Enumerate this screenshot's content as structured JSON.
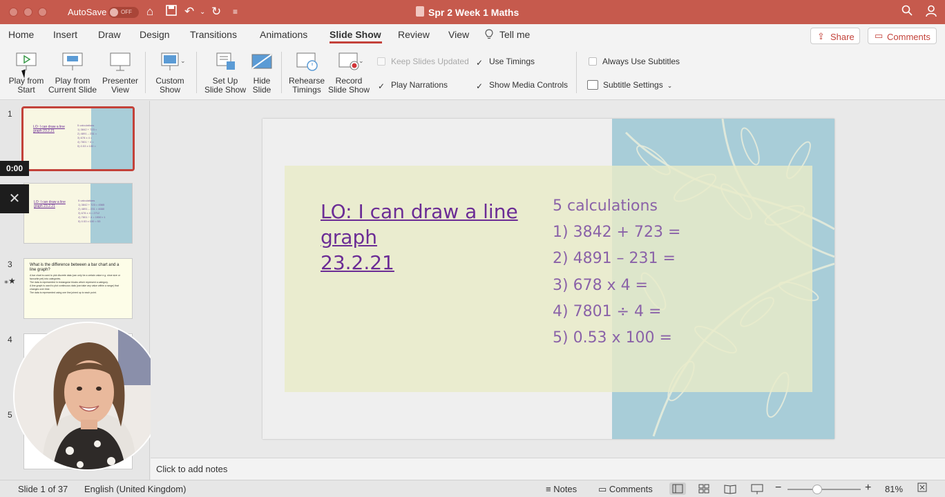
{
  "titlebar": {
    "autosave_label": "AutoSave",
    "autosave_state": "OFF",
    "document_title": "Spr 2 Week 1 Maths"
  },
  "tabs": [
    "Home",
    "Insert",
    "Draw",
    "Design",
    "Transitions",
    "Animations",
    "Slide Show",
    "Review",
    "View",
    "Tell me"
  ],
  "active_tab": "Slide Show",
  "share_label": "Share",
  "comments_label": "Comments",
  "ribbon": {
    "play_from_start": [
      "Play from",
      "Start"
    ],
    "play_from_current": [
      "Play from",
      "Current Slide"
    ],
    "presenter_view": [
      "Presenter",
      "View"
    ],
    "custom_show": [
      "Custom",
      "Show"
    ],
    "setup_show": [
      "Set Up",
      "Slide Show"
    ],
    "hide_slide": [
      "Hide",
      "Slide"
    ],
    "rehearse": [
      "Rehearse",
      "Timings"
    ],
    "record": [
      "Record",
      "Slide Show"
    ],
    "keep_updated": "Keep Slides Updated",
    "play_narrations": "Play Narrations",
    "use_timings": "Use Timings",
    "show_media": "Show Media Controls",
    "always_subtitles": "Always Use Subtitles",
    "subtitle_settings": "Subtitle Settings"
  },
  "thumbnails": {
    "numbers": [
      "1",
      "3",
      "4",
      "5"
    ],
    "slide1_title": "LO: I can draw a line graph 23.2.21",
    "slide1_calc": [
      "5 calculations",
      "1) 3842 + 723 =",
      "2) 4891 – 231 =",
      "3) 678 x 4 =",
      "4) 7801 ÷ 4 =",
      "5) 0.53 x 100 ="
    ],
    "slide2_calc": [
      "5 calculations",
      "1) 3842 + 723 = 4565",
      "2) 4891 – 231 = 4660",
      "3) 678 x 4 = 2712",
      "4) 7801 ÷ 4 = 1950 r 1",
      "5) 0.53 x 100 = 53"
    ],
    "slide3_title": "What is the difference between a bar chart and a line graph?",
    "slide3_text": [
      "A bar chart is used to plot discrete data (can only be a certain value e.g. shoe size or favourite pet) into categories.",
      "The data is represented in rectangular blocks which represent a category.",
      "A line graph is used to plot continuous data (can take any value within a range) that changes over time.",
      "The data is represented using one line joined up to each point."
    ]
  },
  "recording": {
    "timer": "0:00",
    "close": "✕"
  },
  "slide": {
    "title_line1": "LO: I can draw a line",
    "title_line2": "graph",
    "title_line3": "23.2.21",
    "calc_heading": "5 calculations",
    "calc_lines": [
      "1)  3842 + 723 =",
      "2)  4891 – 231 =",
      "3)  678 x 4 =",
      "4)  7801 ÷ 4 =",
      "5)  0.53 x 100 ="
    ]
  },
  "notes_placeholder": "Click to add notes",
  "status": {
    "slide_count": "Slide 1 of 37",
    "language": "English (United Kingdom)",
    "notes": "Notes",
    "comments": "Comments",
    "zoom": "81%",
    "zoom_level": 0.81
  },
  "colors": {
    "titlebar": "#c65a4d",
    "accent": "#c3423a",
    "slide_title": "#6b2c95",
    "slide_text": "#8a62a8"
  }
}
